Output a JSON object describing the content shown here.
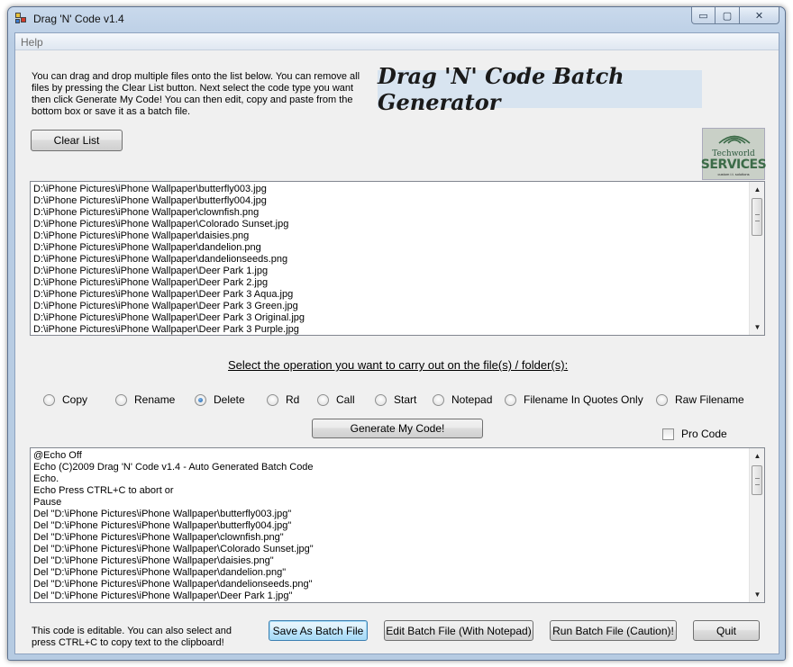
{
  "window": {
    "title": "Drag 'N' Code v1.4",
    "controls": {
      "minimize": "▭",
      "maximize": "▢",
      "close": "✕"
    }
  },
  "menu": {
    "items": [
      "Help"
    ]
  },
  "header": {
    "instructions": "You can drag and drop multiple files onto the list below. You can remove all files by pressing the Clear List button. Next select the code type you want then click Generate My Code! You can then edit, copy and paste from the bottom box or save it as a batch file.",
    "banner": "Drag 'N' Code Batch Generator",
    "logo": {
      "line1": "Techworld",
      "line2": "SERVICES",
      "line3": "custom i.t. solutions"
    }
  },
  "clear_list_label": "Clear List",
  "file_list": [
    "D:\\iPhone Pictures\\iPhone Wallpaper\\butterfly003.jpg",
    "D:\\iPhone Pictures\\iPhone Wallpaper\\butterfly004.jpg",
    "D:\\iPhone Pictures\\iPhone Wallpaper\\clownfish.png",
    "D:\\iPhone Pictures\\iPhone Wallpaper\\Colorado Sunset.jpg",
    "D:\\iPhone Pictures\\iPhone Wallpaper\\daisies.png",
    "D:\\iPhone Pictures\\iPhone Wallpaper\\dandelion.png",
    "D:\\iPhone Pictures\\iPhone Wallpaper\\dandelionseeds.png",
    "D:\\iPhone Pictures\\iPhone Wallpaper\\Deer Park 1.jpg",
    "D:\\iPhone Pictures\\iPhone Wallpaper\\Deer Park 2.jpg",
    "D:\\iPhone Pictures\\iPhone Wallpaper\\Deer Park 3 Aqua.jpg",
    "D:\\iPhone Pictures\\iPhone Wallpaper\\Deer Park 3 Green.jpg",
    "D:\\iPhone Pictures\\iPhone Wallpaper\\Deer Park 3 Original.jpg",
    "D:\\iPhone Pictures\\iPhone Wallpaper\\Deer Park 3 Purple.jpg"
  ],
  "operation_label": "Select the operation you want to carry out on the file(s) / folder(s):",
  "operations": [
    {
      "label": "Copy",
      "checked": false
    },
    {
      "label": "Rename",
      "checked": false
    },
    {
      "label": "Delete",
      "checked": true
    },
    {
      "label": "Rd",
      "checked": false
    },
    {
      "label": "Call",
      "checked": false
    },
    {
      "label": "Start",
      "checked": false
    },
    {
      "label": "Notepad",
      "checked": false
    },
    {
      "label": "Filename In Quotes Only",
      "checked": false
    },
    {
      "label": "Raw Filename",
      "checked": false
    }
  ],
  "generate_label": "Generate My Code!",
  "pro_code": {
    "label": "Pro Code",
    "checked": false
  },
  "code_lines": [
    "@Echo Off",
    "Echo (C)2009 Drag 'N' Code v1.4 - Auto Generated Batch Code",
    "Echo.",
    "Echo Press CTRL+C to abort or",
    "Pause",
    "Del \"D:\\iPhone Pictures\\iPhone Wallpaper\\butterfly003.jpg\"",
    "Del \"D:\\iPhone Pictures\\iPhone Wallpaper\\butterfly004.jpg\"",
    "Del \"D:\\iPhone Pictures\\iPhone Wallpaper\\clownfish.png\"",
    "Del \"D:\\iPhone Pictures\\iPhone Wallpaper\\Colorado Sunset.jpg\"",
    "Del \"D:\\iPhone Pictures\\iPhone Wallpaper\\daisies.png\"",
    "Del \"D:\\iPhone Pictures\\iPhone Wallpaper\\dandelion.png\"",
    "Del \"D:\\iPhone Pictures\\iPhone Wallpaper\\dandelionseeds.png\"",
    "Del \"D:\\iPhone Pictures\\iPhone Wallpaper\\Deer Park 1.jpg\""
  ],
  "footer": {
    "note": "This code is editable. You can also select and press CTRL+C to copy text to the clipboard!",
    "save_label": "Save As Batch File",
    "edit_label": "Edit Batch File (With Notepad)",
    "run_label": "Run Batch File (Caution)!",
    "quit_label": "Quit"
  }
}
